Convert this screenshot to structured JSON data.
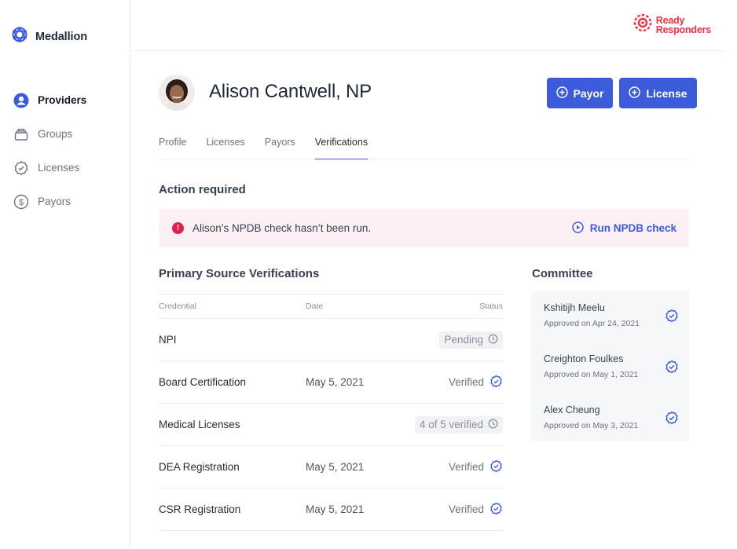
{
  "brand": {
    "name": "Medallion"
  },
  "partner_logo": {
    "line1": "Ready",
    "line2": "Responders"
  },
  "nav": {
    "items": [
      {
        "label": "Providers",
        "icon": "person-icon",
        "active": true
      },
      {
        "label": "Groups",
        "icon": "stack-icon",
        "active": false
      },
      {
        "label": "Licenses",
        "icon": "badge-check-icon",
        "active": false
      },
      {
        "label": "Payors",
        "icon": "dollar-icon",
        "active": false
      }
    ]
  },
  "provider": {
    "name": "Alison Cantwell, NP"
  },
  "actions": {
    "payor_label": "Payor",
    "license_label": "License"
  },
  "tabs": [
    {
      "label": "Profile",
      "active": false
    },
    {
      "label": "Licenses",
      "active": false
    },
    {
      "label": "Payors",
      "active": false
    },
    {
      "label": "Verifications",
      "active": true
    }
  ],
  "action_required": {
    "title": "Action required",
    "alert_text": "Alison’s NPDB check hasn’t been run.",
    "action_label": "Run NPDB check"
  },
  "psv": {
    "title": "Primary Source Verifications",
    "columns": {
      "credential": "Credential",
      "date": "Date",
      "status": "Status"
    },
    "rows": [
      {
        "credential": "NPI",
        "date": "",
        "status": "Pending",
        "kind": "pending"
      },
      {
        "credential": "Board Certification",
        "date": "May 5, 2021",
        "status": "Verified",
        "kind": "verified"
      },
      {
        "credential": "Medical Licenses",
        "date": "",
        "status": "4 of 5 verified",
        "kind": "pending"
      },
      {
        "credential": "DEA Registration",
        "date": "May 5, 2021",
        "status": "Verified",
        "kind": "verified"
      },
      {
        "credential": "CSR Registration",
        "date": "May 5, 2021",
        "status": "Verified",
        "kind": "verified"
      }
    ]
  },
  "committee": {
    "title": "Committee",
    "members": [
      {
        "name": "Kshitijh Meelu",
        "approved": "Approved on Apr 24, 2021"
      },
      {
        "name": "Creighton Foulkes",
        "approved": "Approved on May 1, 2021"
      },
      {
        "name": "Alex Cheung",
        "approved": "Approved on May 3, 2021"
      }
    ]
  },
  "colors": {
    "accent": "#3b5bdb",
    "danger": "#e11d48",
    "brand_red": "#ef3340",
    "alert_bg": "#fdf0f4"
  }
}
